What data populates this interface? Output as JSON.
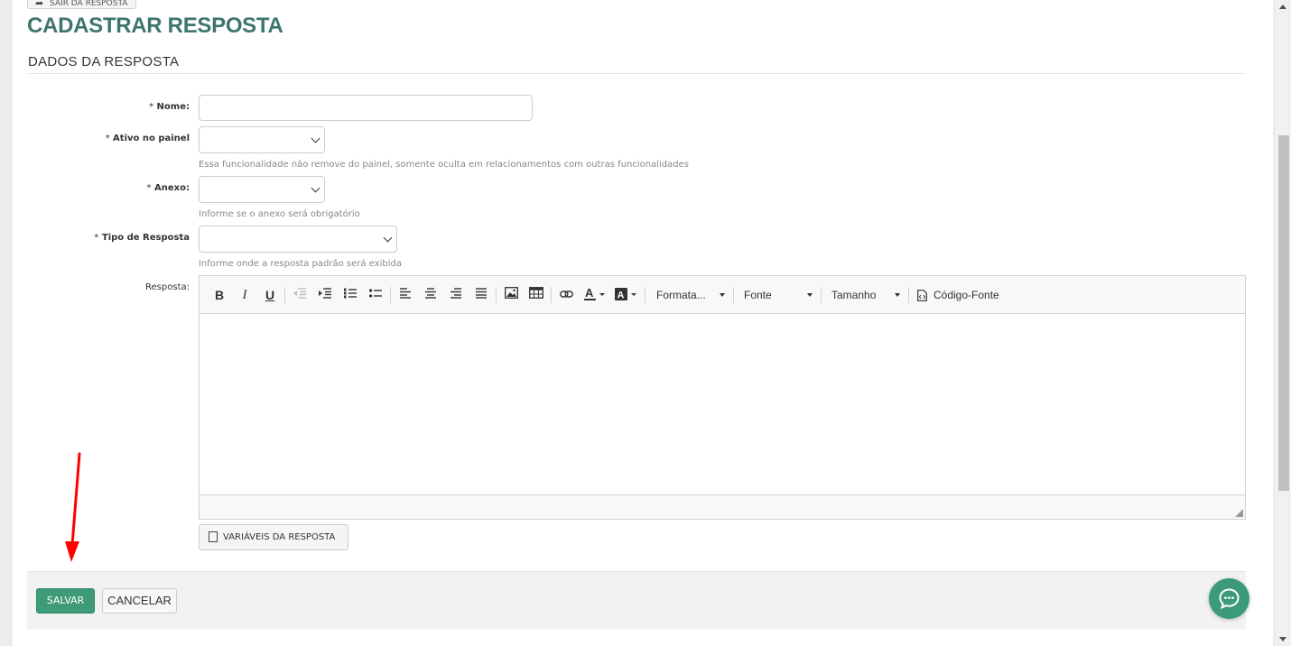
{
  "header": {
    "back_button": "SAIR DA RESPOSTA",
    "title": "CADASTRAR RESPOSTA",
    "section": "DADOS DA RESPOSTA"
  },
  "form": {
    "name_label": "Nome:",
    "active_label": "Ativo no painel",
    "active_help": "Essa funcionalidade não remove do painel, somente oculta em relacionamentos com outras funcionalidades",
    "attachment_label": "Anexo:",
    "attachment_help": "Informe se o anexo será obrigatório",
    "type_label": "Tipo de Resposta",
    "type_help": "Informe onde a resposta padrão será exibida",
    "response_label": "Resposta:",
    "required_mark": "*"
  },
  "editor": {
    "bold": "B",
    "italic": "I",
    "underline": "U",
    "format_combo": "Formata...",
    "font_combo": "Fonte",
    "size_combo": "Tamanho",
    "source_button": "Código-Fonte"
  },
  "variables_button": "VARIÁVEIS DA RESPOSTA",
  "footer": {
    "save": "SALVAR",
    "cancel": "CANCELAR"
  },
  "colors": {
    "title": "#3e766d",
    "save_button": "#3f9a77",
    "chat_button": "#3b9a78",
    "annotation_arrow": "#ff0000"
  }
}
